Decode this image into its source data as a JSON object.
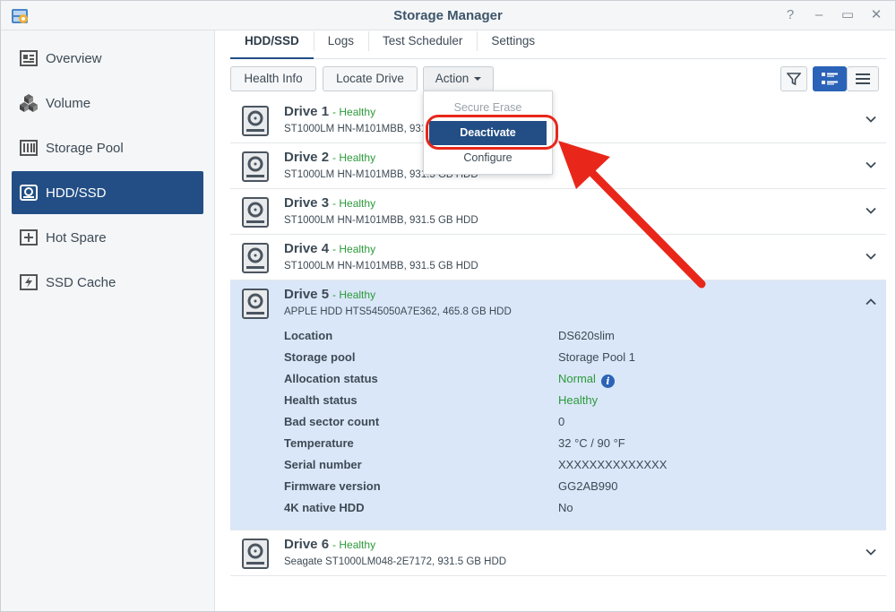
{
  "window": {
    "title": "Storage Manager",
    "controls": [
      "?",
      "–",
      "▭",
      "✕"
    ]
  },
  "sidebar": {
    "items": [
      {
        "label": "Overview",
        "icon": "overview-icon"
      },
      {
        "label": "Volume",
        "icon": "volume-icon"
      },
      {
        "label": "Storage Pool",
        "icon": "storage-pool-icon"
      },
      {
        "label": "HDD/SSD",
        "icon": "hdd-icon",
        "active": true
      },
      {
        "label": "Hot Spare",
        "icon": "hot-spare-icon"
      },
      {
        "label": "SSD Cache",
        "icon": "ssd-cache-icon"
      }
    ]
  },
  "tabs": [
    "HDD/SSD",
    "Logs",
    "Test Scheduler",
    "Settings"
  ],
  "toolbar": {
    "health_info": "Health Info",
    "locate_drive": "Locate Drive",
    "action": "Action"
  },
  "action_menu": {
    "items": [
      "Secure Erase",
      "Deactivate",
      "Configure"
    ],
    "disabled": [
      "Secure Erase"
    ],
    "selected": "Deactivate"
  },
  "drives": [
    {
      "name": "Drive 1",
      "status": "- Healthy",
      "desc": "ST1000LM HN-M101MBB, 931.5 GB HDD"
    },
    {
      "name": "Drive 2",
      "status": "- Healthy",
      "desc": "ST1000LM HN-M101MBB, 931.5 GB HDD"
    },
    {
      "name": "Drive 3",
      "status": "- Healthy",
      "desc": "ST1000LM HN-M101MBB, 931.5 GB HDD"
    },
    {
      "name": "Drive 4",
      "status": "- Healthy",
      "desc": "ST1000LM HN-M101MBB, 931.5 GB HDD"
    },
    {
      "name": "Drive 5",
      "status": "- Healthy",
      "desc": "APPLE HDD HTS545050A7E362, 465.8 GB HDD",
      "expanded": true
    },
    {
      "name": "Drive 6",
      "status": "- Healthy",
      "desc": "Seagate ST1000LM048-2E7172, 931.5 GB HDD"
    }
  ],
  "details": [
    {
      "label": "Location",
      "value": "DS620slim"
    },
    {
      "label": "Storage pool",
      "value": "Storage Pool 1"
    },
    {
      "label": "Allocation status",
      "value": "Normal"
    },
    {
      "label": "Health status",
      "value": "Healthy"
    },
    {
      "label": "Bad sector count",
      "value": "0"
    },
    {
      "label": "Temperature",
      "value": "32 °C / 90 °F"
    },
    {
      "label": "Serial number",
      "value": "XXXXXXXXXXXXXX"
    },
    {
      "label": "Firmware version",
      "value": "GG2AB990"
    },
    {
      "label": "4K native HDD",
      "value": "No"
    }
  ],
  "colors": {
    "accent": "#224e85",
    "healthy": "#2b9a3a",
    "annotation": "#e8271a"
  }
}
